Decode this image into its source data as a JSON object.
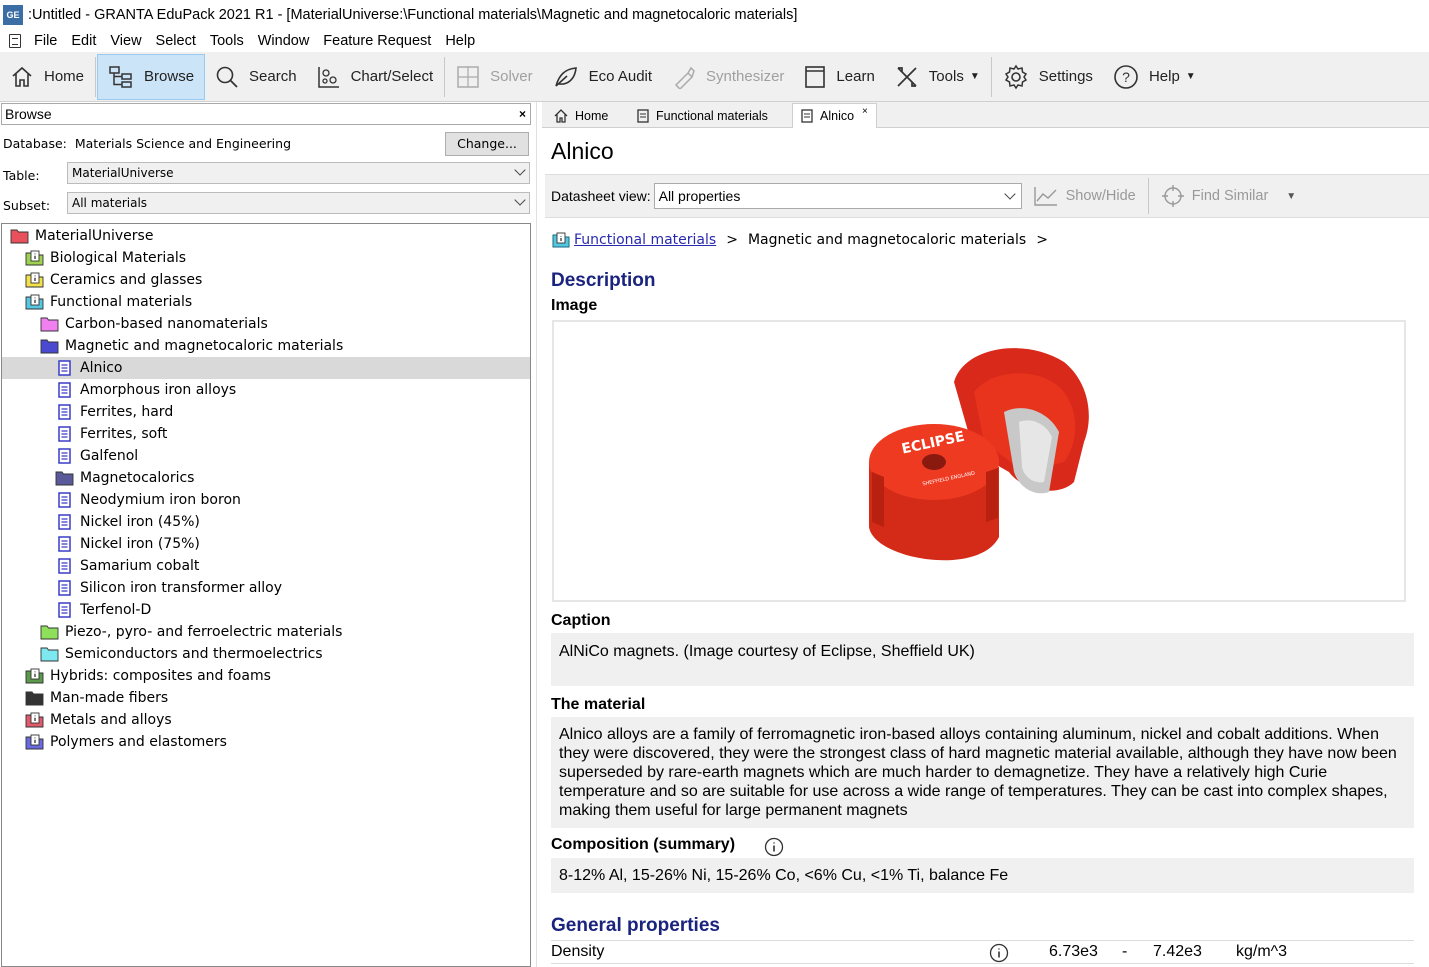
{
  "window": {
    "logo_text": "GE",
    "title": ":Untitled - GRANTA EduPack 2021 R1 - [MaterialUniverse:\\Functional materials\\Magnetic and magnetocaloric materials]"
  },
  "menu": [
    "File",
    "Edit",
    "View",
    "Select",
    "Tools",
    "Window",
    "Feature Request",
    "Help"
  ],
  "toolbar": {
    "home": "Home",
    "browse": "Browse",
    "search": "Search",
    "chart_select": "Chart/Select",
    "solver": "Solver",
    "eco_audit": "Eco Audit",
    "synthesizer": "Synthesizer",
    "learn": "Learn",
    "tools": "Tools",
    "settings": "Settings",
    "help": "Help"
  },
  "browse_panel": {
    "header": "Browse",
    "close": "×",
    "database_label": "Database:",
    "database_value": "Materials Science and Engineering",
    "change_button": "Change...",
    "table_label": "Table:",
    "table_value": "MaterialUniverse",
    "subset_label": "Subset:",
    "subset_value": "All materials"
  },
  "tree": [
    {
      "label": "MaterialUniverse",
      "level": 0,
      "icon": "folder",
      "color": "#e8505b"
    },
    {
      "label": "Biological Materials",
      "level": 1,
      "icon": "info-folder",
      "color": "#9ed14f"
    },
    {
      "label": "Ceramics and glasses",
      "level": 1,
      "icon": "info-folder",
      "color": "#f2e14a"
    },
    {
      "label": "Functional materials",
      "level": 1,
      "icon": "info-folder",
      "color": "#56c7e0"
    },
    {
      "label": "Carbon-based nanomaterials",
      "level": 2,
      "icon": "folder",
      "color": "#f07ff0"
    },
    {
      "label": "Magnetic and magnetocaloric materials",
      "level": 2,
      "icon": "folder",
      "color": "#4a4ad0"
    },
    {
      "label": "Alnico",
      "level": 3,
      "icon": "doc",
      "color": "#3b3bc8",
      "selected": true
    },
    {
      "label": "Amorphous iron alloys",
      "level": 3,
      "icon": "doc",
      "color": "#3b3bc8"
    },
    {
      "label": "Ferrites, hard",
      "level": 3,
      "icon": "doc",
      "color": "#3b3bc8"
    },
    {
      "label": "Ferrites, soft",
      "level": 3,
      "icon": "doc",
      "color": "#3b3bc8"
    },
    {
      "label": "Galfenol",
      "level": 3,
      "icon": "doc",
      "color": "#3b3bc8"
    },
    {
      "label": "Magnetocalorics",
      "level": 3,
      "icon": "folder",
      "color": "#5a5a9a"
    },
    {
      "label": "Neodymium iron boron",
      "level": 3,
      "icon": "doc",
      "color": "#3b3bc8"
    },
    {
      "label": "Nickel iron (45%)",
      "level": 3,
      "icon": "doc",
      "color": "#3b3bc8"
    },
    {
      "label": "Nickel iron (75%)",
      "level": 3,
      "icon": "doc",
      "color": "#3b3bc8"
    },
    {
      "label": "Samarium cobalt",
      "level": 3,
      "icon": "doc",
      "color": "#3b3bc8"
    },
    {
      "label": "Silicon iron transformer alloy",
      "level": 3,
      "icon": "doc",
      "color": "#3b3bc8"
    },
    {
      "label": "Terfenol-D",
      "level": 3,
      "icon": "doc",
      "color": "#3b3bc8"
    },
    {
      "label": "Piezo-, pyro- and ferroelectric materials",
      "level": 2,
      "icon": "folder",
      "color": "#8ee05a"
    },
    {
      "label": "Semiconductors and thermoelectrics",
      "level": 2,
      "icon": "folder",
      "color": "#7ee8f0"
    },
    {
      "label": "Hybrids: composites and foams",
      "level": 1,
      "icon": "info-folder",
      "color": "#5a9a4a"
    },
    {
      "label": "Man-made fibers",
      "level": 1,
      "icon": "folder",
      "color": "#333333"
    },
    {
      "label": "Metals and alloys",
      "level": 1,
      "icon": "info-folder",
      "color": "#e05a6a"
    },
    {
      "label": "Polymers and elastomers",
      "level": 1,
      "icon": "info-folder",
      "color": "#6a6ae0"
    }
  ],
  "tabs": [
    {
      "label": "Home",
      "icon": "home-icon"
    },
    {
      "label": "Functional materials",
      "icon": "doc-icon"
    },
    {
      "label": "Alnico",
      "icon": "doc-icon",
      "active": true,
      "close": "×"
    }
  ],
  "datasheet": {
    "title": "Alnico",
    "view_label": "Datasheet view:",
    "view_value": "All properties",
    "show_hide": "Show/Hide",
    "find_similar": "Find Similar",
    "breadcrumb_link": "Functional materials",
    "breadcrumb_sep": ">",
    "breadcrumb_current": "Magnetic and magnetocaloric materials",
    "breadcrumb_trail": ">",
    "description_heading": "Description",
    "image_label": "Image",
    "caption_label": "Caption",
    "caption_value": "AlNiCo magnets. (Image courtesy of Eclipse, Sheffield UK)",
    "material_label": "The material",
    "material_value": "Alnico alloys are a family of ferromagnetic iron-based alloys containing aluminum, nickel and cobalt additions. When they were discovered, they were the strongest class of hard magnetic material available, although they have now been superseded by rare-earth magnets which are much harder to demagnetize. They have a relatively high Curie temperature and so are suitable for use across a wide range of temperatures. They can be cast into complex shapes, making them useful for large permanent magnets",
    "composition_label": "Composition (summary)",
    "composition_value": "8-12% Al, 15-26% Ni, 15-26% Co, <6% Cu, <1% Ti, balance Fe",
    "general_heading": "General properties",
    "density_label": "Density",
    "density_min": "6.73e3",
    "density_dash": "-",
    "density_max": "7.42e3",
    "density_unit": "kg/m^3"
  },
  "magnet_image": {
    "brand_text": "ECLIPSE",
    "sub_text": "SHEFFIELD ENGLAND",
    "body_color": "#e8331d"
  }
}
